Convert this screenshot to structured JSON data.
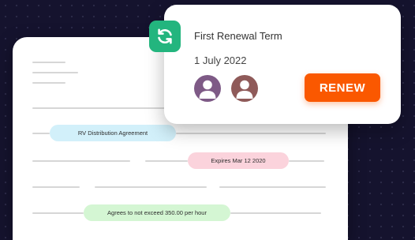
{
  "document": {
    "highlights": {
      "agreement": "RV Distribution Agreement",
      "expiry": "Expires Mar 12 2020",
      "limit": "Agrees to not exceed 350.00 per hour"
    }
  },
  "renewal": {
    "icon": "sync-icon",
    "title": "First Renewal Term",
    "date": "1 July 2022",
    "avatars": [
      "user-avatar-icon",
      "user-avatar-icon"
    ],
    "renew_label": "RENEW",
    "colors": {
      "accent": "#fa5800",
      "badge": "#23b57e",
      "avatar_1": "#7e5a86",
      "avatar_2": "#8f5a59"
    }
  },
  "colors": {
    "background": "#15132e",
    "highlight_blue": "#d2f0fa",
    "highlight_pink": "#fbd3dc",
    "highlight_green": "#d4f6d3"
  }
}
